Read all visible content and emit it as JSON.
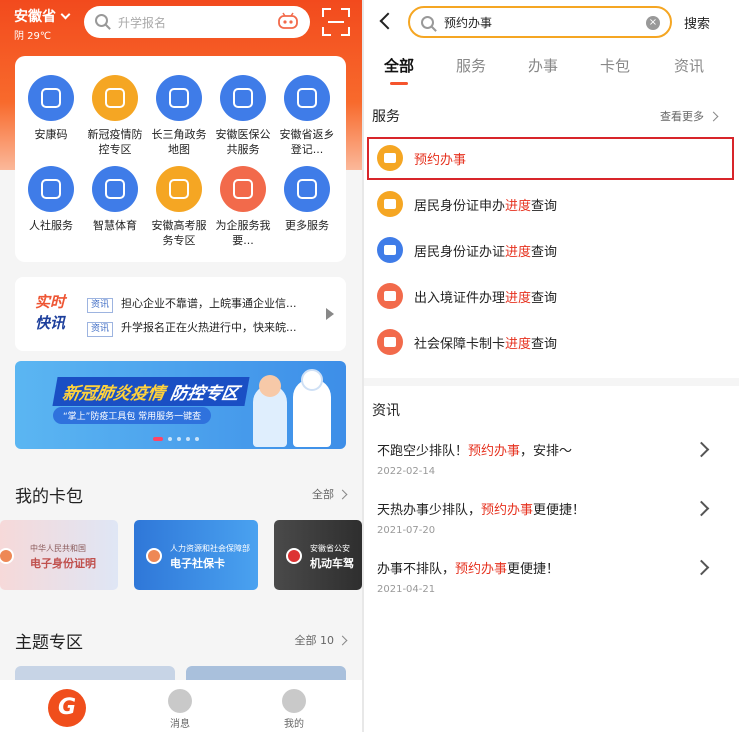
{
  "left": {
    "province": "安徽省",
    "weather": "阴 29℃",
    "search_placeholder": "升学报名",
    "services": [
      {
        "label": "安康码",
        "icon": "qr-code-icon",
        "color": "#3f7ce8"
      },
      {
        "label": "新冠疫情防控专区",
        "icon": "virus-icon",
        "color": "#f5a623"
      },
      {
        "label": "长三角政务地图",
        "icon": "map-icon",
        "color": "#3f7ce8"
      },
      {
        "label": "安徽医保公共服务",
        "icon": "medical-card-icon",
        "color": "#3f7ce8"
      },
      {
        "label": "安徽省返乡登记...",
        "icon": "heart-plus-icon",
        "color": "#3f7ce8"
      },
      {
        "label": "人社服务",
        "icon": "social-service-icon",
        "color": "#3f7ce8"
      },
      {
        "label": "智慧体育",
        "icon": "runner-icon",
        "color": "#3f7ce8"
      },
      {
        "label": "安徽高考服务专区",
        "icon": "exam-icon",
        "color": "#f5a623"
      },
      {
        "label": "为企服务我要...",
        "icon": "mail-icon",
        "color": "#f26a4b"
      },
      {
        "label": "更多服务",
        "icon": "grid-icon",
        "color": "#3f7ce8"
      }
    ],
    "news": {
      "badge_top": "实时",
      "badge_bottom": "快讯",
      "items": [
        {
          "tag": "资讯",
          "text": "担心企业不靠谱，上皖事通企业信..."
        },
        {
          "tag": "资讯",
          "text": "升学报名正在火热进行中，快来皖..."
        }
      ]
    },
    "banner": {
      "title_a": "新冠肺炎疫情",
      "title_b": "防控专区",
      "subtitle": "“掌上”防疫工具包 常用服务一键查"
    },
    "cards_section": {
      "title": "我的卡包",
      "more": "全部"
    },
    "cards": [
      {
        "top": "中华人民共和国",
        "name": "电子身份证明"
      },
      {
        "top": "人力资源和社会保障部",
        "name": "电子社保卡"
      },
      {
        "top": "安徽省公安",
        "name": "机动车驾"
      }
    ],
    "theme_section": {
      "title": "主题专区",
      "more": "全部 10"
    },
    "tabbar": [
      {
        "label": ""
      },
      {
        "label": "消息"
      },
      {
        "label": "我的"
      }
    ],
    "home_glyph": "G"
  },
  "right": {
    "search_value": "预约办事",
    "search_button": "搜索",
    "tabs": [
      "全部",
      "服务",
      "办事",
      "卡包",
      "资讯"
    ],
    "services_title": "服务",
    "services_more": "查看更多",
    "service_items": [
      {
        "pre": "",
        "hl": "预约办事",
        "post": "",
        "color": "#f5a623",
        "icon": "calendar-icon"
      },
      {
        "pre": "居民身份证申办",
        "hl": "进度",
        "post": "查询",
        "color": "#f5a623",
        "icon": "id-card-icon"
      },
      {
        "pre": "居民身份证办证",
        "hl": "进度",
        "post": "查询",
        "color": "#3f7ce8",
        "icon": "id-card-icon"
      },
      {
        "pre": "出入境证件办理",
        "hl": "进度",
        "post": "查询",
        "color": "#f26a4b",
        "icon": "passport-icon"
      },
      {
        "pre": "社会保障卡制卡",
        "hl": "进度",
        "post": "查询",
        "color": "#f26a4b",
        "icon": "social-card-icon"
      }
    ],
    "news_title": "资讯",
    "news_items": [
      {
        "pre": "不跑空少排队！",
        "hl": "预约办事",
        "post": "，安排～",
        "date": "2022-02-14"
      },
      {
        "pre": "天热办事少排队，",
        "hl": "预约办事",
        "post": "更便捷！",
        "date": "2021-07-20"
      },
      {
        "pre": "办事不排队，",
        "hl": "预约办事",
        "post": "更便捷！",
        "date": "2021-04-21"
      }
    ]
  },
  "colors": {
    "brand": "#f24a1d",
    "highlight": "#e6321f",
    "accent": "#f5a623"
  }
}
